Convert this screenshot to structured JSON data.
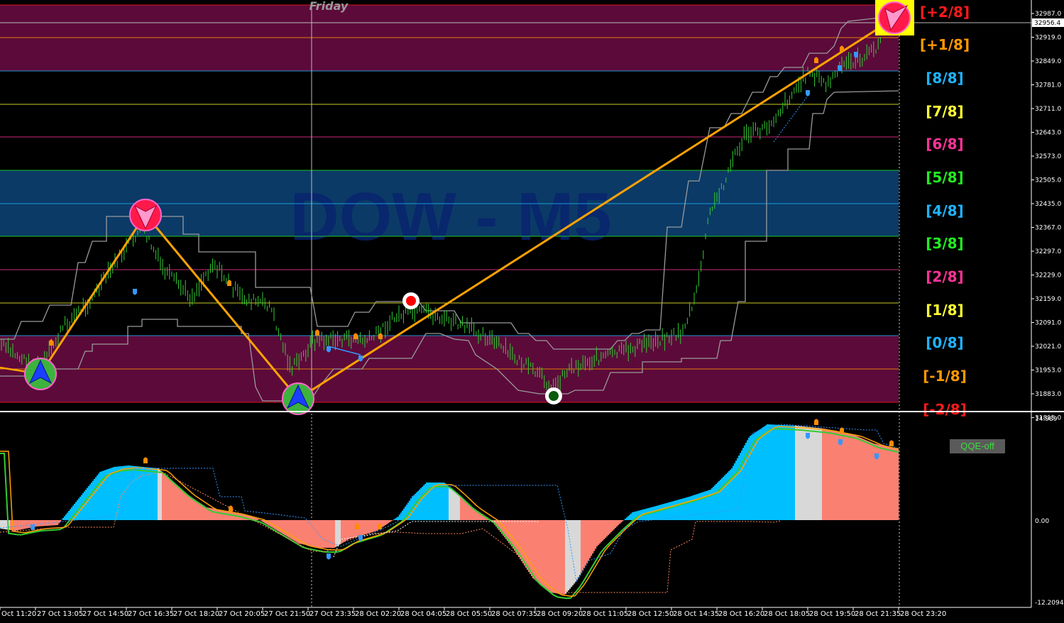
{
  "chart": {
    "symbol_watermark": "DOW - M5",
    "session_label": "Friday",
    "current_price": "32956.4",
    "indicator_button_label": "QQE-off"
  },
  "murrey_levels": [
    {
      "label": "[+2/8]",
      "color": "#ff1a1a"
    },
    {
      "label": "[+1/8]",
      "color": "#ff9900"
    },
    {
      "label": "[8/8]",
      "color": "#1eb4ff"
    },
    {
      "label": "[7/8]",
      "color": "#ffff33"
    },
    {
      "label": "[6/8]",
      "color": "#ff3399"
    },
    {
      "label": "[5/8]",
      "color": "#22ee22"
    },
    {
      "label": "[4/8]",
      "color": "#1eb4ff"
    },
    {
      "label": "[3/8]",
      "color": "#22ee22"
    },
    {
      "label": "[2/8]",
      "color": "#ff3399"
    },
    {
      "label": "[1/8]",
      "color": "#ffff33"
    },
    {
      "label": "[0/8]",
      "color": "#1eb4ff"
    },
    {
      "label": "[-1/8]",
      "color": "#ff9900"
    },
    {
      "label": "[-2/8]",
      "color": "#ff1a1a"
    }
  ],
  "price_axis": [
    "32987.0",
    "32919.0",
    "32849.0",
    "32781.0",
    "32711.0",
    "32643.0",
    "32573.0",
    "32505.0",
    "32435.0",
    "32367.0",
    "32297.0",
    "32229.0",
    "32159.0",
    "32091.0",
    "32021.0",
    "31953.0",
    "31883.0",
    "31815.0"
  ],
  "indicator_axis": [
    "14.989",
    "0.00",
    "-12.2094"
  ],
  "time_axis": [
    "Oct 11:20",
    "27 Oct 13:05",
    "27 Oct 14:50",
    "27 Oct 16:35",
    "27 Oct 18:20",
    "27 Oct 20:05",
    "27 Oct 21:50",
    "27 Oct 23:35",
    "28 Oct 02:20",
    "28 Oct 04:05",
    "28 Oct 05:50",
    "28 Oct 07:35",
    "28 Oct 09:20",
    "28 Oct 11:05",
    "28 Oct 12:50",
    "28 Oct 14:35",
    "28 Oct 16:20",
    "28 Oct 18:05",
    "28 Oct 19:50",
    "28 Oct 21:35",
    "28 Oct 23:20"
  ],
  "colors": {
    "zone_extreme": "#5c0a3a",
    "zone_middle": "#0b3a66",
    "candle": "#33cc33",
    "zigzag": "#ffa200",
    "band": "#9a9a9a",
    "hist_up": "#00bfff",
    "hist_down": "#fa8072",
    "hist_neutral": "#d8d8d8",
    "qqe_line": "#33cc33"
  }
}
